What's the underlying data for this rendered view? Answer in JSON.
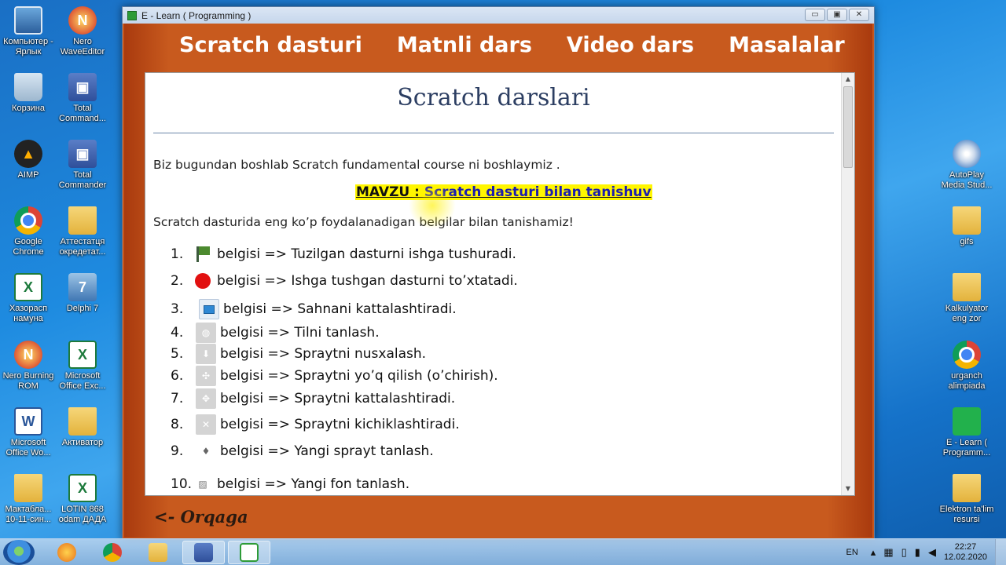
{
  "desktop": {
    "left_icons": [
      {
        "label": "Компьютер - Ярлык",
        "icon": "computer-icon"
      },
      {
        "label": "Nero WaveEditor",
        "icon": "nero-icon"
      },
      {
        "label": "Корзина",
        "icon": "recycle-bin-icon"
      },
      {
        "label": "Total Command...",
        "icon": "floppy-icon"
      },
      {
        "label": "AIMP",
        "icon": "aimp-icon"
      },
      {
        "label": "Total Commander",
        "icon": "floppy-icon"
      },
      {
        "label": "Google Chrome",
        "icon": "chrome-icon"
      },
      {
        "label": "Аттестатця окредетат...",
        "icon": "winrar-icon"
      },
      {
        "label": "Хазорасп намуна",
        "icon": "excel-icon"
      },
      {
        "label": "Delphi 7",
        "icon": "delphi-icon"
      },
      {
        "label": "Nero Burning ROM",
        "icon": "nero-icon"
      },
      {
        "label": "Microsoft Office Exc...",
        "icon": "excel-icon"
      },
      {
        "label": "Microsoft Office Wo...",
        "icon": "word-icon"
      },
      {
        "label": "Активатор",
        "icon": "folder-icon"
      },
      {
        "label": "Мактабла... 10-11-син...",
        "icon": "folder-icon"
      },
      {
        "label": "LOTIN 868 odam ДАДА",
        "icon": "excel-icon"
      }
    ],
    "right_icons": [
      {
        "label": "AutoPlay Media Stud...",
        "icon": "autoplay-icon"
      },
      {
        "label": "gifs",
        "icon": "folder-icon"
      },
      {
        "label": "Kalkulyator eng zor",
        "icon": "folder-icon"
      },
      {
        "label": "urganch alimpiada",
        "icon": "chrome-icon"
      },
      {
        "label": "E - Learn ( Programm...",
        "icon": "elearn-icon"
      },
      {
        "label": "Elektron ta'lim resursi",
        "icon": "folder-icon"
      }
    ]
  },
  "window": {
    "title": "E - Learn ( Programming )",
    "buttons": {
      "minimize": "▭",
      "maximize": "▣",
      "close": "✕"
    }
  },
  "menu": [
    "Scratch dasturi",
    "Matnli dars",
    "Video dars",
    "Masalalar"
  ],
  "page": {
    "title": "Scratch  darslari",
    "intro": "Biz bugundan boshlab Scratch fundamental course ni boshlaymiz .",
    "topic_prefix": "MAVZU  :  ",
    "topic_text": "Scratch dasturi bilan tanishuv",
    "intro2": "Scratch dasturida  eng ko’p foydalanadigan belgilar bilan tanishamiz!",
    "items": [
      {
        "num": "1.",
        "icon": "green-flag-icon",
        "text": "belgisi  =>  Tuzilgan dasturni ishga tushuradi."
      },
      {
        "num": "2.",
        "icon": "stop-icon",
        "text": "belgisi  =>  Ishga tushgan dasturni to’xtatadi."
      },
      {
        "num": "3.",
        "icon": "fullscreen-stage-icon",
        "text": "belgisi  =>  Sahnani kattalashtiradi."
      },
      {
        "num": "4.",
        "icon": "globe-icon",
        "text": "belgisi  =>  Tilni tanlash."
      },
      {
        "num": "5.",
        "icon": "duplicate-icon",
        "text": "belgisi  =>  Spraytni nusxalash."
      },
      {
        "num": "6.",
        "icon": "delete-icon",
        "text": "belgisi  =>  Spraytni yo’q qilish (o’chirish)."
      },
      {
        "num": "7.",
        "icon": "grow-icon",
        "text": "belgisi  =>  Spraytni kattalashtiradi."
      },
      {
        "num": "8.",
        "icon": "shrink-icon",
        "text": "belgisi  =>  Spraytni kichiklashtiradi."
      },
      {
        "num": "9.",
        "icon": "new-sprite-icon",
        "text": "belgisi  =>  Yangi sprayt tanlash."
      },
      {
        "num": "10.",
        "icon": "new-backdrop-icon",
        "text": "belgisi  =>  Yangi fon tanlash."
      }
    ],
    "back_link": "<-  Orqaga"
  },
  "taskbar": {
    "lang": "EN",
    "time": "22:27",
    "date": "12.02.2020"
  }
}
